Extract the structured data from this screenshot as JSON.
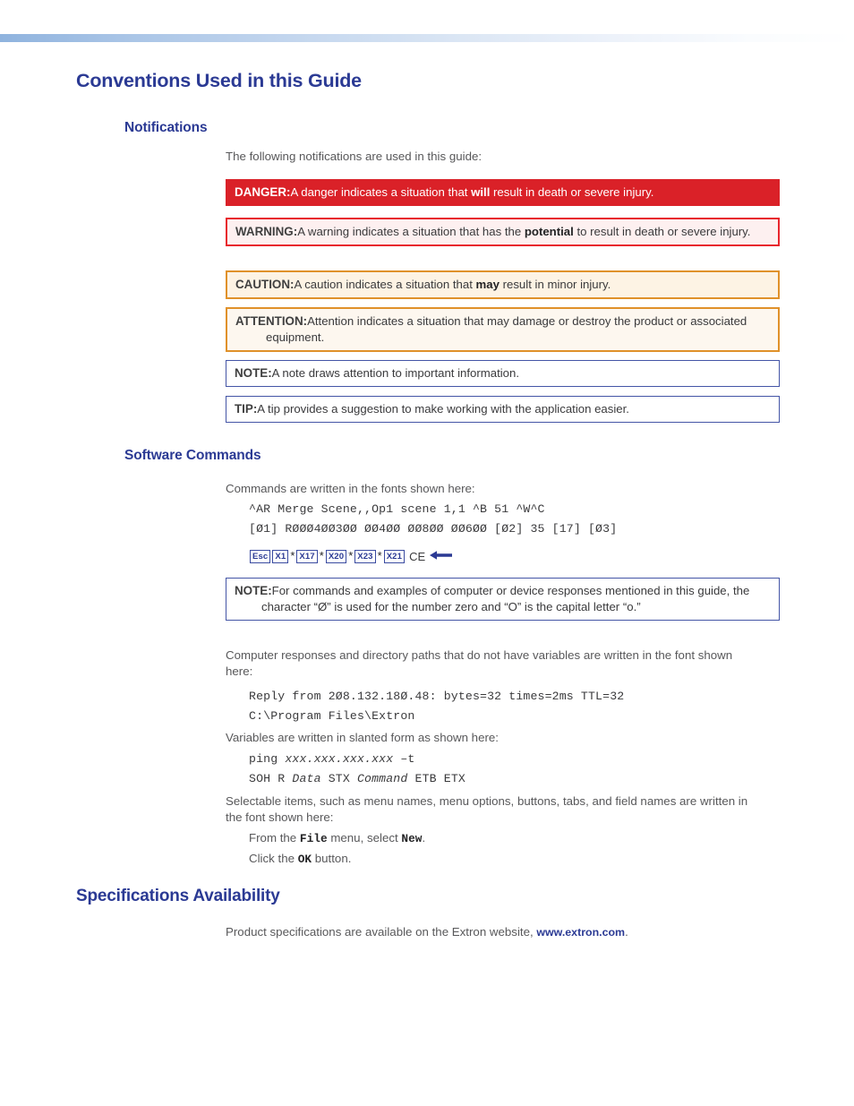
{
  "page": {
    "chapter_title": "Conventions Used in this Guide"
  },
  "notifications": {
    "section_title": "Notifications",
    "intro": "The following notifications are used in this guide:",
    "items": [
      {
        "kind": "danger",
        "label": "DANGER:",
        "text_before": "A danger indicates a situation that ",
        "emphasis": "will",
        "text_after": " result in death or severe injury."
      },
      {
        "kind": "warning",
        "label": "WARNING:",
        "text_before": "A warning indicates a situation that has the ",
        "emphasis": "potential",
        "text_after": " to result in death or severe injury."
      },
      {
        "kind": "caution",
        "label": "CAUTION:",
        "text_before": "A caution indicates a situation that ",
        "emphasis": "may",
        "text_after": " result in minor injury."
      },
      {
        "kind": "attention",
        "label": "ATTENTION:",
        "text_before": "Attention indicates a situation that may damage or destroy the product or associated equipment.",
        "emphasis": "",
        "text_after": ""
      },
      {
        "kind": "note",
        "label": "NOTE:",
        "text_before": "A note draws attention to important information.",
        "emphasis": "",
        "text_after": ""
      },
      {
        "kind": "tip",
        "label": "TIP:",
        "text_before": "A tip provides a suggestion to make working with the application easier.",
        "emphasis": "",
        "text_after": ""
      }
    ]
  },
  "software_commands": {
    "section_title": "Software Commands",
    "intro": "Commands are written in the fonts shown here:",
    "code_line_1": "^AR Merge Scene,,Op1 scene 1,1 ^B 51 ^W^C",
    "code_line_2": "[Ø1] RØØØ4ØØ3ØØ ØØ4ØØ ØØ8ØØ ØØ6ØØ [Ø2] 35 [17] [Ø3]",
    "keys": {
      "cap_1": "Esc",
      "cap_2": "X1",
      "sep_1": "*",
      "cap_3": "X17",
      "sep_2": "*",
      "cap_4": "X20",
      "sep_3": "*",
      "cap_5": "X23",
      "sep_4": "*",
      "cap_6": "X21",
      "trailing": "CE",
      "arrow_icon": "left-arrow-icon"
    },
    "note": {
      "label": "NOTE:",
      "text": "For commands and examples of computer or device responses mentioned in this guide, the character “Ø” is used for the number zero and “O” is the capital letter “o.”"
    },
    "responses_intro": "Computer responses and directory paths that do not have variables are written in the font shown here:",
    "response_line_1": "Reply from 2Ø8.132.18Ø.48: bytes=32 times=2ms TTL=32",
    "response_line_2": "C:\\Program Files\\Extron",
    "variables_intro": "Variables are written in slanted form as shown here:",
    "variable_line_1_pre": "ping ",
    "variable_line_1_var": "xxx.xxx.xxx.xxx",
    "variable_line_1_post": " –t",
    "variable_line_2_a": "SOH R ",
    "variable_line_2_var1": "Data",
    "variable_line_2_b": " STX ",
    "variable_line_2_var2": "Command",
    "variable_line_2_c": " ETB ETX",
    "selectable_intro": "Selectable items, such as menu names, menu options, buttons, tabs, and field names are written in the font shown here:",
    "example_1_a": "From the ",
    "example_1_mono1": "File",
    "example_1_b": " menu, select ",
    "example_1_mono2": "New",
    "example_1_c": ".",
    "example_2_a": "Click the ",
    "example_2_mono": "OK",
    "example_2_b": " button."
  },
  "specifications": {
    "section_title": "Specifications Availability",
    "text_before": "Product specifications are available on the Extron website, ",
    "link": "www.extron.com",
    "text_after": "."
  },
  "colors": {
    "heading_blue": "#2b3a94",
    "danger_red": "#da2128",
    "warning_red": "#e8262d",
    "caution_orange": "#e0912a",
    "note_blue": "#4455a6",
    "body_gray": "#58585a"
  }
}
